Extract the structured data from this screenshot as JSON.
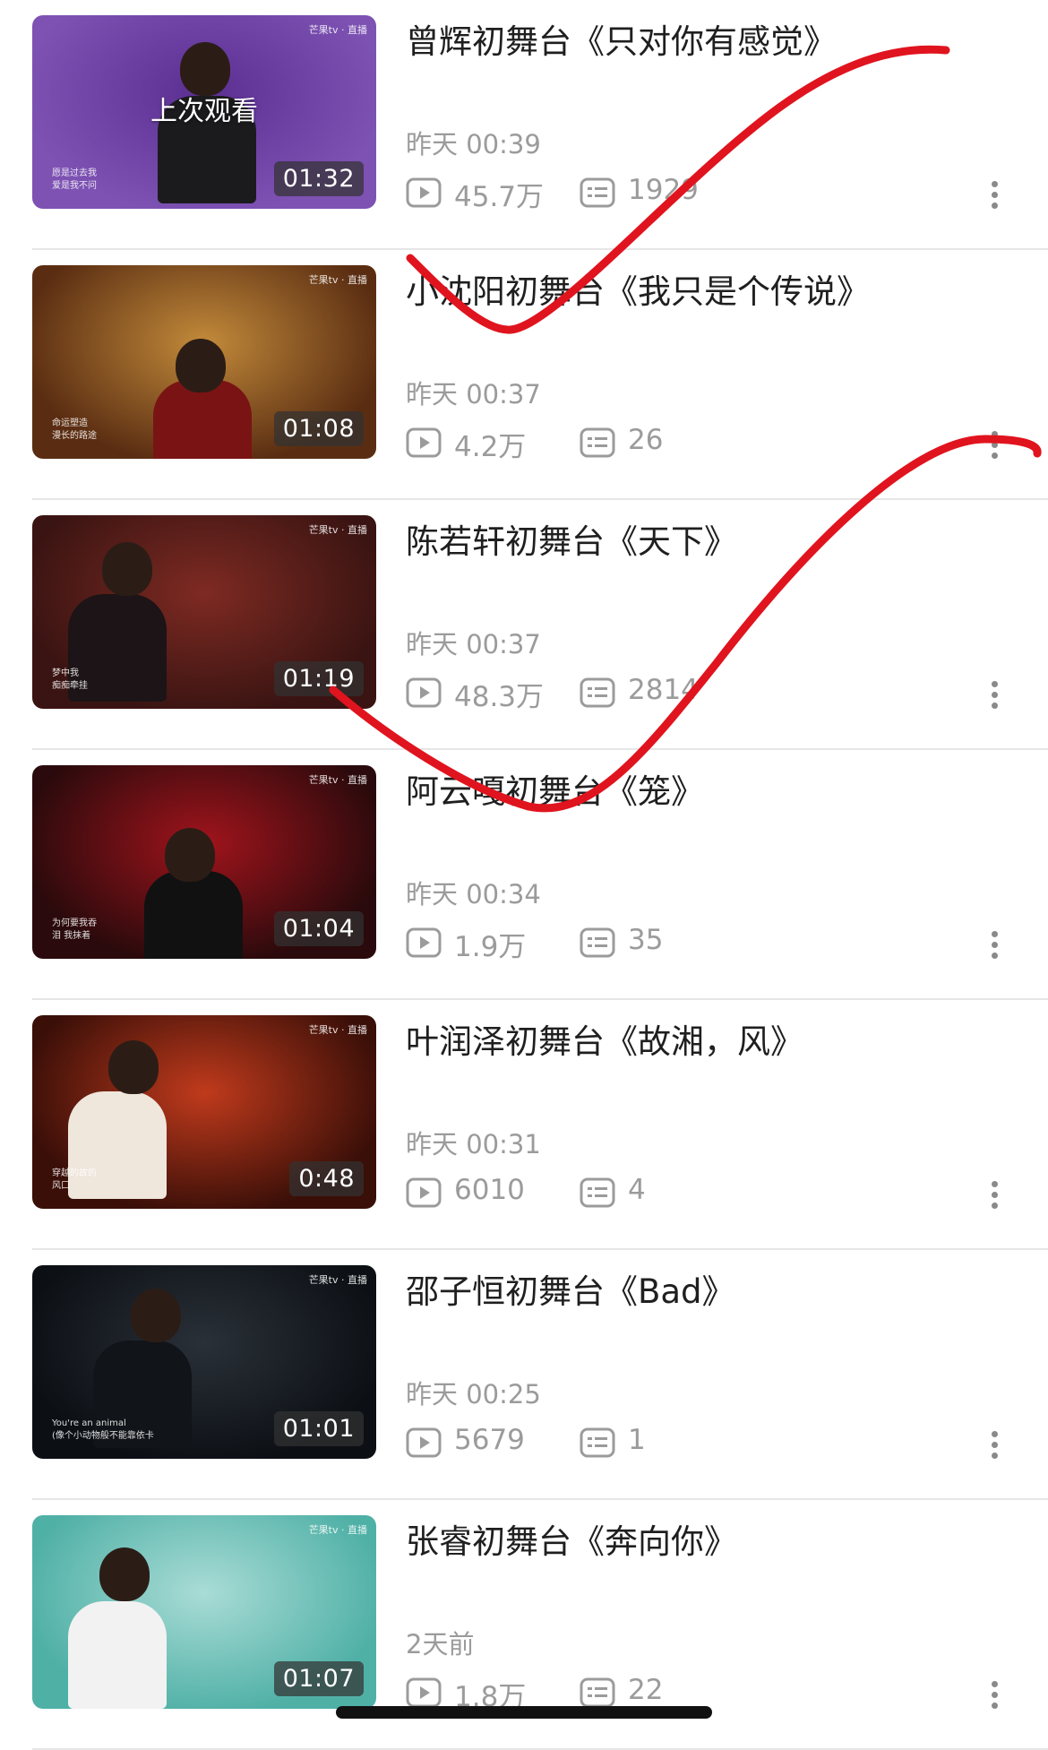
{
  "items": [
    {
      "title": "曾辉初舞台《只对你有感觉》",
      "time": "昨天 00:39",
      "views": "45.7万",
      "comments": "1929",
      "duration": "01:32",
      "last_watched": "上次观看",
      "colors": [
        "#7d52b3",
        "#5b2f92"
      ],
      "subtitle": [
        "",
        "愿是过去我",
        "爱是我不问"
      ]
    },
    {
      "title": "小沈阳初舞台《我只是个传说》",
      "time": "昨天 00:37",
      "views": "4.2万",
      "comments": "26",
      "duration": "01:08",
      "colors": [
        "#5a2d12",
        "#c28a3a"
      ],
      "subtitle": [
        "命运塑造",
        "漫长的路途"
      ]
    },
    {
      "title": "陈若轩初舞台《天下》",
      "time": "昨天 00:37",
      "views": "48.3万",
      "comments": "2814",
      "duration": "01:19",
      "colors": [
        "#3a1412",
        "#7e2a22"
      ],
      "subtitle": [
        "梦中我",
        "痴痴牵挂"
      ]
    },
    {
      "title": "阿云嘎初舞台《笼》",
      "time": "昨天 00:34",
      "views": "1.9万",
      "comments": "35",
      "duration": "01:04",
      "colors": [
        "#2a0a0c",
        "#a0141c"
      ],
      "subtitle": [
        "为何要我吞",
        "泪 我抹着"
      ]
    },
    {
      "title": "叶润泽初舞台《故湘，风》",
      "time": "昨天 00:31",
      "views": "6010",
      "comments": "4",
      "duration": "0:48",
      "colors": [
        "#3a0f08",
        "#c03a1c"
      ],
      "subtitle": [
        "穿越的故的",
        "风口"
      ]
    },
    {
      "title": "邵子恒初舞台《Bad》",
      "time": "昨天 00:25",
      "views": "5679",
      "comments": "1",
      "duration": "01:01",
      "colors": [
        "#0c1015",
        "#2a3038"
      ],
      "subtitle": [
        "You're an animal",
        "(像个小动物般不能靠依卡"
      ]
    },
    {
      "title": "张睿初舞台《奔向你》",
      "time": "2天前",
      "views": "1.8万",
      "comments": "22",
      "duration": "01:07",
      "colors": [
        "#4fb0a6",
        "#a9dcd6"
      ],
      "subtitle": [
        "",
        ""
      ]
    }
  ],
  "brand_label": "芒果tv · 直播",
  "icons": {
    "play": "play-count-icon",
    "danmaku": "danmaku-icon",
    "more": "more-dots-icon"
  },
  "accent_scribble": "#e0141e"
}
